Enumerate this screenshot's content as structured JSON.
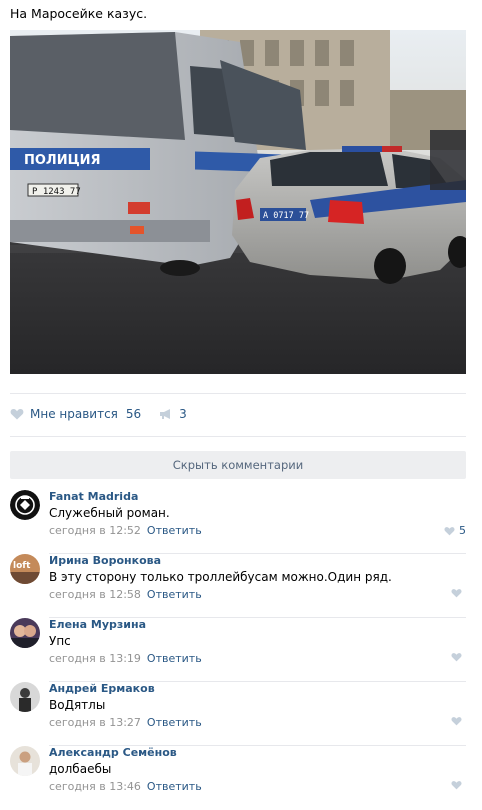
{
  "post": {
    "text": "На Маросейке казус.",
    "photo_labels": {
      "bus_label": "ПОЛИЦИЯ",
      "bus_plate": "Р 1243 77",
      "car_plate": "А 0717 77"
    },
    "likes_label": "Мне нравится",
    "likes_count": "56",
    "shares_count": "3"
  },
  "hide_comments_label": "Скрыть комментарии",
  "comments": [
    {
      "author": "Fanat Madrida",
      "text": "Служебный роман.",
      "time": "сегодня в 12:52",
      "reply": "Ответить",
      "likes": "5"
    },
    {
      "author": "Ирина Воронкова",
      "text": "В эту сторону только троллейбусам можно.Один ряд.",
      "time": "сегодня в 12:58",
      "reply": "Ответить",
      "likes": ""
    },
    {
      "author": "Елена Мурзина",
      "text": "Упс",
      "time": "сегодня в 13:19",
      "reply": "Ответить",
      "likes": ""
    },
    {
      "author": "Андрей Ермаков",
      "text": "ВоДятлы",
      "time": "сегодня в 13:27",
      "reply": "Ответить",
      "likes": ""
    },
    {
      "author": "Александр Семёнов",
      "text": "долбаебы",
      "time": "сегодня в 13:46",
      "reply": "Ответить",
      "likes": ""
    }
  ],
  "colors": {
    "link": "#2a5885",
    "meta": "#939393",
    "button_bg": "#edeef0",
    "separator": "#e7e8ec"
  }
}
